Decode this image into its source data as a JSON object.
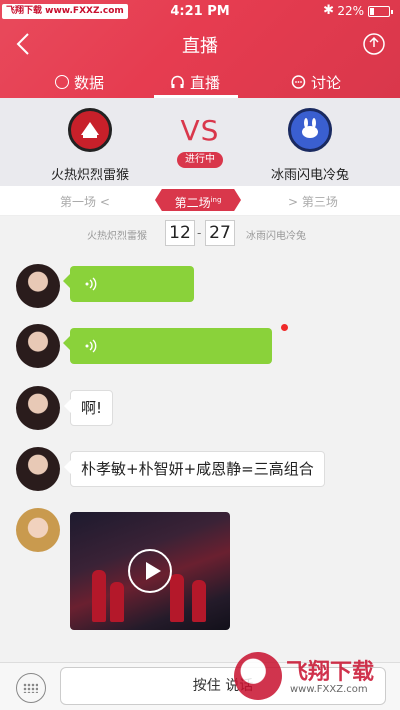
{
  "statusbar": {
    "watermark": "飞翔下载 www.FXXZ.com",
    "time": "4:21 PM",
    "battery_text": "22%",
    "battery_level": 0.22
  },
  "nav": {
    "title": "直播"
  },
  "tabs": [
    {
      "label": "数据",
      "icon": "chart-icon"
    },
    {
      "label": "直播",
      "icon": "headphones-icon",
      "active": true
    },
    {
      "label": "讨论",
      "icon": "chat-icon"
    }
  ],
  "match": {
    "team_left": {
      "name": "火热炽烈雷猴",
      "logo_color": "#c8202a"
    },
    "team_right": {
      "name": "冰雨闪电冷兔",
      "logo_color": "#3a5fd0"
    },
    "vs": "VS",
    "status": "进行中"
  },
  "rounds": {
    "prev": "第一场",
    "current": "第二场",
    "current_sup": "ing",
    "next": "第三场"
  },
  "score": {
    "left_team": "火热炽烈雷猴",
    "left_score": "12",
    "right_score": "27",
    "right_team": "冰雨闪电冷兔"
  },
  "messages": {
    "m3": "啊!",
    "m4": "朴孝敏+朴智妍+咸恩静=三高组合"
  },
  "bottom": {
    "hold_to_talk": "按住 说话"
  },
  "brandmark": {
    "name": "飞翔下载",
    "url": "www.FXXZ.com"
  },
  "colors": {
    "accent": "#d9374b",
    "voice_bubble": "#8ad23a"
  }
}
